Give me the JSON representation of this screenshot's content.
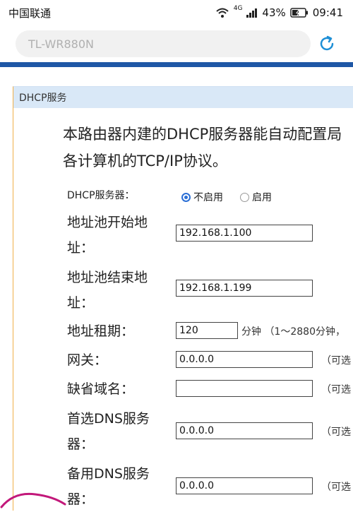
{
  "status_bar": {
    "carrier": "中国联通",
    "network": "4G",
    "battery": "43%",
    "time": "09:41"
  },
  "address_bar": {
    "placeholder": "TL-WR880N"
  },
  "panel": {
    "title": "DHCP服务",
    "description_line1": "本路由器内建的DHCP服务器能自动配置局",
    "description_line2": "各计算机的TCP/IP协议。",
    "dhcp_server": {
      "label": "DHCP服务器：",
      "options": [
        "不启用",
        "启用"
      ],
      "selected": "不启用"
    },
    "fields": {
      "pool_start": {
        "label_line1": "地址池开始地",
        "label_line2": "址：",
        "value": "192.168.1.100"
      },
      "pool_end": {
        "label_line1": "地址池结束地",
        "label_line2": "址：",
        "value": "192.168.1.199"
      },
      "lease": {
        "label": "地址租期：",
        "value": "120",
        "unit": "分钟 （1～2880分钟，"
      },
      "gateway": {
        "label": "网关：",
        "value": "0.0.0.0",
        "hint": "（可选"
      },
      "domain": {
        "label": "缺省域名：",
        "value": "",
        "hint": "（可选"
      },
      "dns_primary": {
        "label_line1": "首选DNS服务",
        "label_line2": "器：",
        "value": "0.0.0.0",
        "hint": "（可选"
      },
      "dns_backup": {
        "label_line1": "备用DNS服务",
        "label_line2": "器：",
        "value": "0.0.0.0",
        "hint": "（可选"
      }
    }
  },
  "colors": {
    "brand_blue": "#1e57a6",
    "panel_header": "#d9e8f7",
    "radio_accent": "#2b6fd6"
  }
}
